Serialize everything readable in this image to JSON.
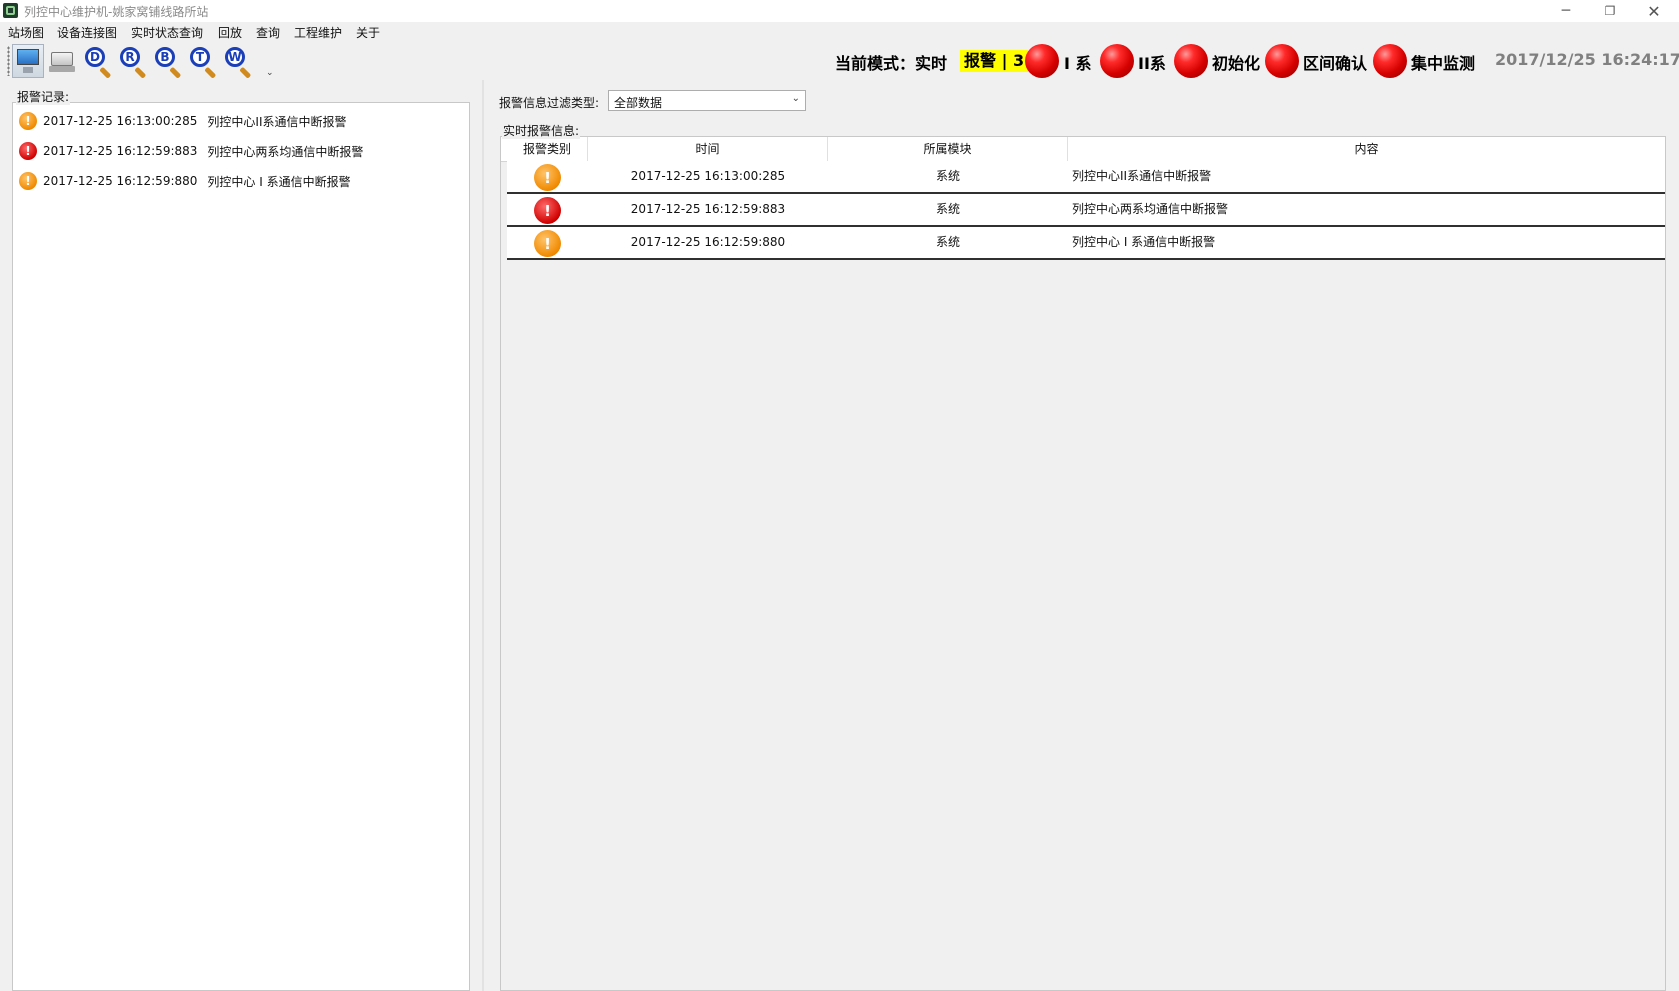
{
  "window": {
    "title": "列控中心维护机-姚家窝铺线路所站",
    "minimize": "─",
    "maximize": "❐",
    "close": "✕"
  },
  "menu": [
    "站场图",
    "设备连接图",
    "实时状态查询",
    "回放",
    "查询",
    "工程维护",
    "关于"
  ],
  "toolbar": {
    "buttons": [
      {
        "icon": "monitor-icon"
      },
      {
        "icon": "drive-icon"
      },
      {
        "icon": "search-d-icon",
        "letter": "D"
      },
      {
        "icon": "search-r-icon",
        "letter": "R"
      },
      {
        "icon": "search-b-icon",
        "letter": "B"
      },
      {
        "icon": "search-t-icon",
        "letter": "T"
      },
      {
        "icon": "search-w-icon",
        "letter": "W"
      }
    ],
    "more": "⌄"
  },
  "status": {
    "mode": "当前模式：实时",
    "alarm": "报警 | 3",
    "indicators": [
      {
        "label": "I 系",
        "color": "#e00000"
      },
      {
        "label": "II系",
        "color": "#e00000"
      },
      {
        "label": "初始化",
        "color": "#e00000"
      },
      {
        "label": "区间确认",
        "color": "#e00000"
      },
      {
        "label": "集中监测",
        "color": "#e00000"
      }
    ],
    "clock": "2017/12/25 16:24:17"
  },
  "left": {
    "group_label": "报警记录:",
    "records": [
      {
        "level": "warning",
        "time": "2017-12-25 16:13:00:285",
        "content": "列控中心II系通信中断报警"
      },
      {
        "level": "critical",
        "time": "2017-12-25 16:12:59:883",
        "content": "列控中心两系均通信中断报警"
      },
      {
        "level": "warning",
        "time": "2017-12-25 16:12:59:880",
        "content": "列控中心 I 系通信中断报警"
      }
    ]
  },
  "right": {
    "filter_label": "报警信息过滤类型:",
    "filter_value": "全部数据",
    "group_label": "实时报警信息:",
    "columns": [
      "报警类别",
      "时间",
      "所属模块",
      "内容"
    ],
    "rows": [
      {
        "level": "warning",
        "time": "2017-12-25 16:13:00:285",
        "module": "系统",
        "content": "列控中心II系通信中断报警"
      },
      {
        "level": "critical",
        "time": "2017-12-25 16:12:59:883",
        "module": "系统",
        "content": "列控中心两系均通信中断报警"
      },
      {
        "level": "warning",
        "time": "2017-12-25 16:12:59:880",
        "module": "系统",
        "content": "列控中心 I 系通信中断报警"
      }
    ]
  },
  "colors": {
    "warning": "#f08a00",
    "critical": "#d00000",
    "alarm_badge": "#ffff00"
  }
}
